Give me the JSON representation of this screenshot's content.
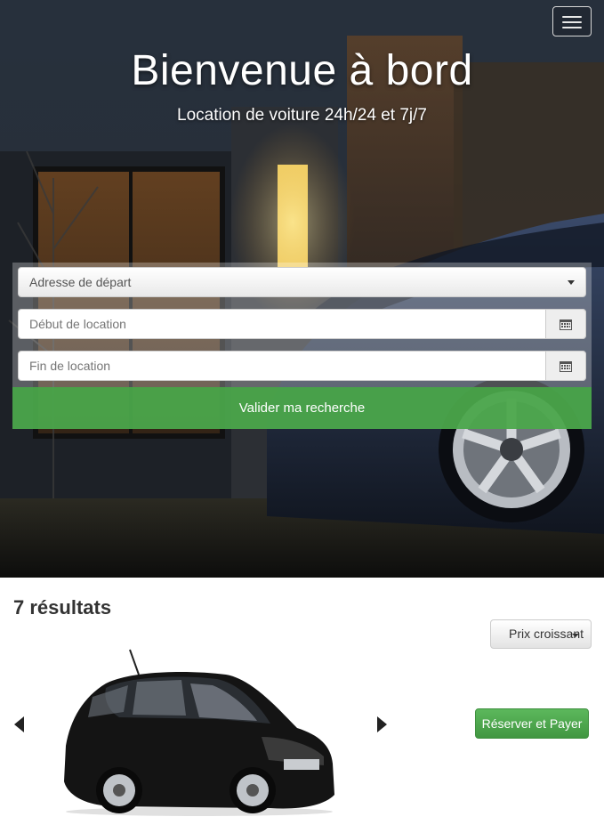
{
  "navbar": {
    "menu_icon": "hamburger-icon"
  },
  "hero": {
    "title": "Bienvenue à bord",
    "subtitle": "Location de voiture 24h/24 et 7j/7"
  },
  "search": {
    "departure_select": "Adresse de départ",
    "start_placeholder": "Début de location",
    "end_placeholder": "Fin de location",
    "calendar_icon": "calendar-icon",
    "submit_label": "Valider ma recherche"
  },
  "results": {
    "count": "7",
    "count_label": "résultats",
    "sort_label": "Prix croissant",
    "prev_icon": "caret-left-icon",
    "next_icon": "caret-right-icon",
    "book_label": "Réserver et Payer"
  },
  "colors": {
    "accent_green": "#5cb85c",
    "panel_overlay": "rgba(255,255,255,0.28)"
  }
}
